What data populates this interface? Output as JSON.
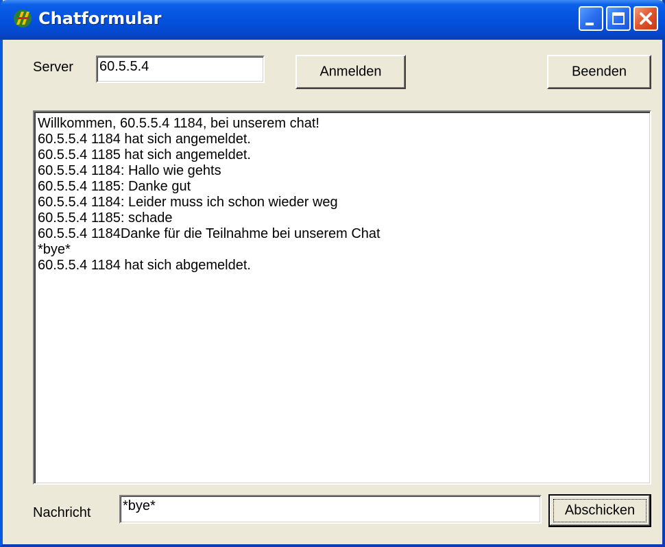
{
  "window": {
    "title": "Chatformular",
    "icon": "app-icon"
  },
  "titlebar_buttons": {
    "minimize_icon": "minimize-icon",
    "maximize_icon": "maximize-icon",
    "close_icon": "close-icon"
  },
  "server": {
    "label": "Server",
    "value": "60.5.5.4"
  },
  "buttons": {
    "connect": "Anmelden",
    "exit": "Beenden",
    "send": "Abschicken"
  },
  "chat_log": [
    "Willkommen, 60.5.5.4 1184, bei unserem chat!",
    "60.5.5.4 1184 hat sich angemeldet.",
    "60.5.5.4 1185 hat sich angemeldet.",
    "60.5.5.4 1184: Hallo wie gehts",
    "60.5.5.4 1185: Danke gut",
    "60.5.5.4 1184: Leider muss ich schon wieder weg",
    "60.5.5.4 1185: schade",
    "60.5.5.4 1184Danke für die Teilnahme bei unserem Chat",
    "*bye*",
    "60.5.5.4 1184 hat sich abgemeldet."
  ],
  "message": {
    "label": "Nachricht",
    "value": "*bye*"
  },
  "colors": {
    "titlebar": "#0553e0",
    "face": "#ece9d8",
    "close_button": "#e0532a"
  }
}
